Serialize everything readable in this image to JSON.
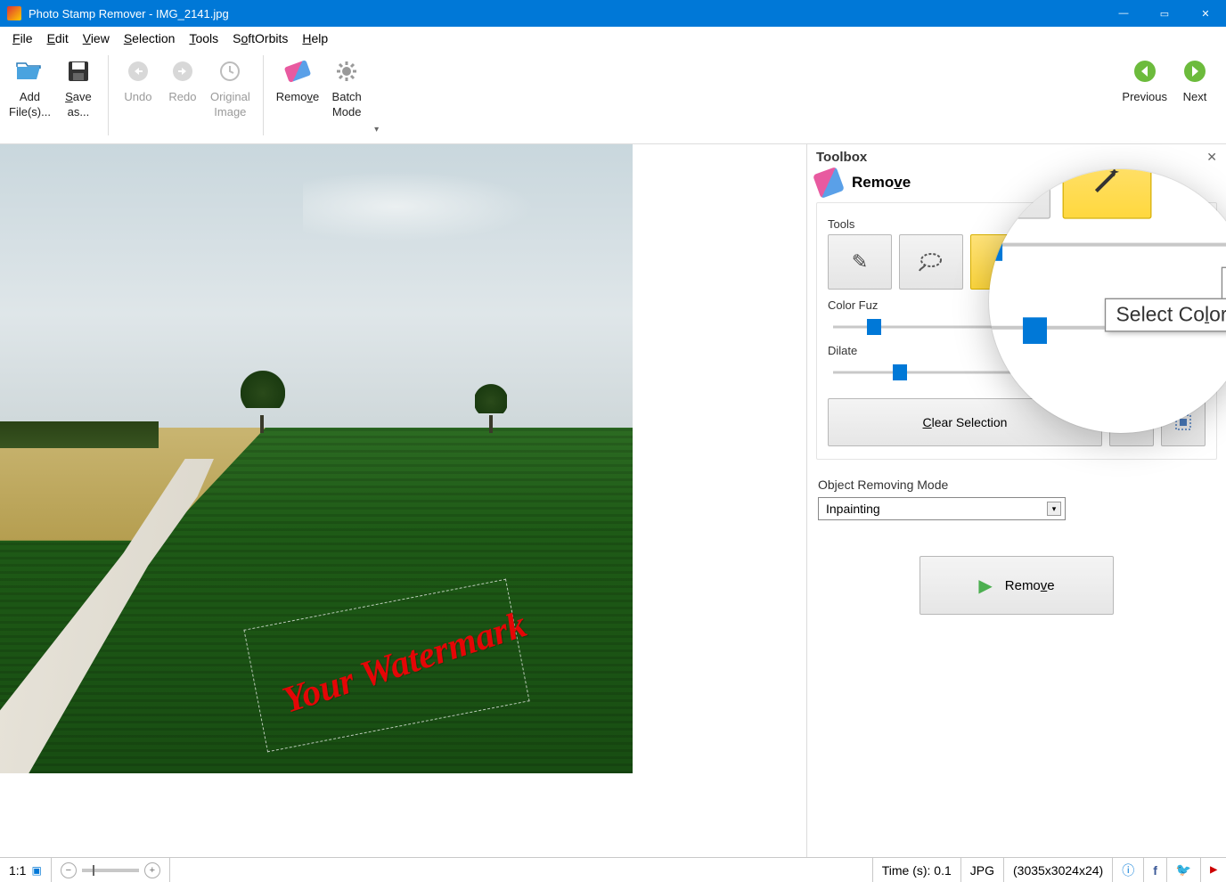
{
  "title": "Photo Stamp Remover - IMG_2141.jpg",
  "menu": {
    "file": "File",
    "edit": "Edit",
    "view": "View",
    "selection": "Selection",
    "tools": "Tools",
    "softorbits": "SoftOrbits",
    "help": "Help"
  },
  "toolbar": {
    "add_files": "Add\nFile(s)...",
    "save_as": "Save\nas...",
    "undo": "Undo",
    "redo": "Redo",
    "original_image": "Original\nImage",
    "remove": "Remove",
    "batch_mode": "Batch\nMode",
    "previous": "Previous",
    "next": "Next"
  },
  "canvas": {
    "watermark_text": "Your Watermark"
  },
  "toolbox": {
    "header": "Toolbox",
    "section_title": "Remove",
    "tools_label": "Tools",
    "color_fuzziness_label": "Color Fuzziness",
    "color_fuzziness_label_truncated": "Color Fuz",
    "color_fuzziness_value": "0",
    "dilate_label": "Dilate",
    "dilate_value": "2",
    "clear_selection": "Clear Selection",
    "mode_label": "Object Removing Mode",
    "mode_value": "Inpainting",
    "remove_button": "Remove",
    "tooltip": "Select Color",
    "magnifier_value": "0"
  },
  "status": {
    "ratio": "1:1",
    "time": "Time (s): 0.1",
    "format": "JPG",
    "dimensions": "(3035x3024x24)"
  }
}
